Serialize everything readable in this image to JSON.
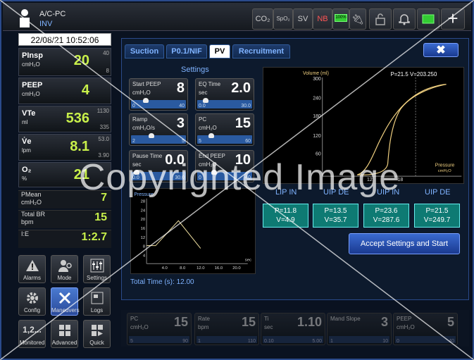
{
  "topbar": {
    "mode": "A/C-PC",
    "patient_type": "INV",
    "co2": "CO₂",
    "spo2": "SpO₂",
    "sv": "SV",
    "nb": "NB",
    "battery": "100%"
  },
  "datetime": "22/08/21 10:52:06",
  "vitals": [
    {
      "label": "PInsp",
      "unit": "cmH₂O",
      "value": "20",
      "hi": "40",
      "lo": "8"
    },
    {
      "label": "PEEP",
      "unit": "cmH₂O",
      "value": "4",
      "hi": "",
      "lo": ""
    },
    {
      "label": "VTe",
      "unit": "ml",
      "value": "536",
      "hi": "1130",
      "lo": "335"
    },
    {
      "label": "V̇e",
      "unit": "lpm",
      "value": "8.1",
      "hi": "53.0",
      "lo": "3.90"
    },
    {
      "label": "O₂",
      "unit": "%",
      "value": "21",
      "hi": "",
      "lo": ""
    }
  ],
  "small_vitals": [
    {
      "label": "PMean",
      "unit": "cmH₂O",
      "value": "7"
    },
    {
      "label": "Total BR",
      "unit": "bpm",
      "value": "15"
    },
    {
      "label": "I:E",
      "unit": "",
      "value": "1:2.7"
    }
  ],
  "nav": [
    {
      "label": "Alarms",
      "icon": "alarm-icon"
    },
    {
      "label": "Mode",
      "icon": "mode-icon"
    },
    {
      "label": "Settings",
      "icon": "settings-icon"
    },
    {
      "label": "Config",
      "icon": "gear-icon"
    },
    {
      "label": "Maneuvers",
      "icon": "wrench-icon"
    },
    {
      "label": "Logs",
      "icon": "logs-icon"
    },
    {
      "label": "Monitored",
      "icon": "monitored-icon",
      "glyph": "1,2..."
    },
    {
      "label": "Advanced",
      "icon": "grid-icon"
    },
    {
      "label": "Quick",
      "icon": "quick-icon"
    }
  ],
  "tabs": [
    "Suction",
    "P0.1/NIF",
    "PV",
    "Recruitment"
  ],
  "active_tab": "PV",
  "settings_header": "Settings",
  "knobs": [
    {
      "label": "Start PEEP",
      "unit": "cmH₂O",
      "value": "8",
      "min": "0",
      "max": "40",
      "level": 0.2
    },
    {
      "label": "EQ Time",
      "unit": "sec",
      "value": "2.0",
      "min": "0.0",
      "max": "30.0",
      "level": 0.07
    },
    {
      "label": "Ramp",
      "unit": "cmH₂O/s",
      "value": "3",
      "min": "2",
      "max": "5",
      "level": 0.33
    },
    {
      "label": "PC",
      "unit": "cmH₂O",
      "value": "15",
      "min": "5",
      "max": "60",
      "level": 0.18
    },
    {
      "label": "Pause Time",
      "unit": "sec",
      "value": "0.0",
      "min": "0.0",
      "max": "30.0",
      "level": 0
    },
    {
      "label": "End PEEP",
      "unit": "cmH₂O",
      "value": "10",
      "min": "0",
      "max": "40",
      "level": 0.25
    }
  ],
  "pv_chart": {
    "ylabel": "Volume (ml)",
    "xlabel": "Pressure",
    "xunit": "cmH₂O",
    "yticks": [
      "300",
      "240",
      "180",
      "120",
      "60"
    ],
    "xticks": [
      "12",
      "18"
    ],
    "readout": "P=21.5  V=203.250"
  },
  "pressure_chart": {
    "ylabel": "Pressure",
    "xunit": "sec",
    "yticks": [
      "28",
      "24",
      "20",
      "16",
      "12",
      "8",
      "4"
    ],
    "xticks": [
      "4.0",
      "8.0",
      "12.0",
      "16.0",
      "20.0"
    ]
  },
  "total_time": "Total Time (s): 12.00",
  "measurements": [
    {
      "header": "LIP IN",
      "p": "P=11.8",
      "v": "V=4.9"
    },
    {
      "header": "UIP DE",
      "p": "P=13.5",
      "v": "V=35.7"
    },
    {
      "header": "UIP IN",
      "p": "P=23.6",
      "v": "V=287.6"
    },
    {
      "header": "UIP DE",
      "p": "P=21.5",
      "v": "V=249.7"
    }
  ],
  "accept_label": "Accept Settings and Start",
  "bottom_knobs": [
    {
      "label": "PC",
      "unit": "cmH₂O",
      "value": "15",
      "min": "5",
      "max": "90"
    },
    {
      "label": "Rate",
      "unit": "bpm",
      "value": "15",
      "min": "1",
      "max": "110"
    },
    {
      "label": "Ti",
      "unit": "sec",
      "value": "1.10",
      "min": "0.10",
      "max": "5.00"
    },
    {
      "label": "Mand Slope",
      "unit": "",
      "value": "3",
      "min": "1",
      "max": "10"
    },
    {
      "label": "PEEP",
      "unit": "cmH₂O",
      "value": "5",
      "min": "0",
      "max": "40"
    }
  ],
  "watermark": "Copyrighted Image",
  "colors": {
    "accent": "#7fb3ff",
    "value_green": "#c8f04a",
    "teal": "#0e7a73",
    "curve": "#f0d080"
  }
}
